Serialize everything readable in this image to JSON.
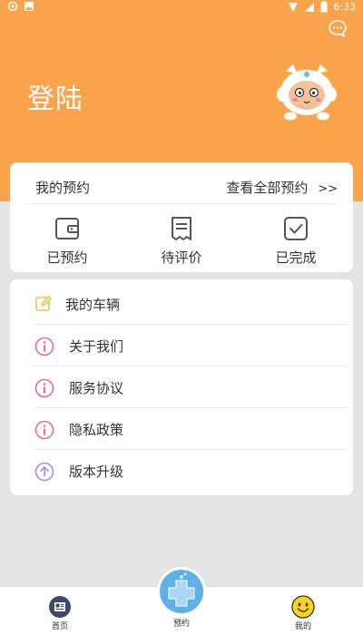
{
  "status_bar": {
    "time": "6:33"
  },
  "header": {
    "title": "登陆",
    "message_icon": "chat-bubble-icon"
  },
  "appointments": {
    "title": "我的预约",
    "view_all": "查看全部预约",
    "view_all_arrow": ">>",
    "tabs": [
      {
        "label": "已预约",
        "icon": "wallet-icon"
      },
      {
        "label": "待评价",
        "icon": "receipt-icon"
      },
      {
        "label": "已完成",
        "icon": "check-box-icon"
      }
    ]
  },
  "menu": [
    {
      "label": "我的车辆",
      "icon": "edit-icon"
    },
    {
      "label": "关于我们",
      "icon": "info-icon"
    },
    {
      "label": "服务协议",
      "icon": "info-icon"
    },
    {
      "label": "隐私政策",
      "icon": "info-icon"
    },
    {
      "label": "版本升级",
      "icon": "upgrade-icon"
    }
  ],
  "bottom_nav": [
    {
      "label": "首页",
      "icon": "home-icon"
    },
    {
      "label": "预约",
      "icon": "medical-cross-icon"
    },
    {
      "label": "我的",
      "icon": "smiley-icon"
    }
  ],
  "colors": {
    "header_bg": "#f9a34a",
    "page_bg": "#e4e4e4",
    "info_icon": "#e8689a",
    "edit_icon": "#f2c24e",
    "upgrade_icon": "#a98bdc",
    "center_button": "#5fb2e3"
  }
}
